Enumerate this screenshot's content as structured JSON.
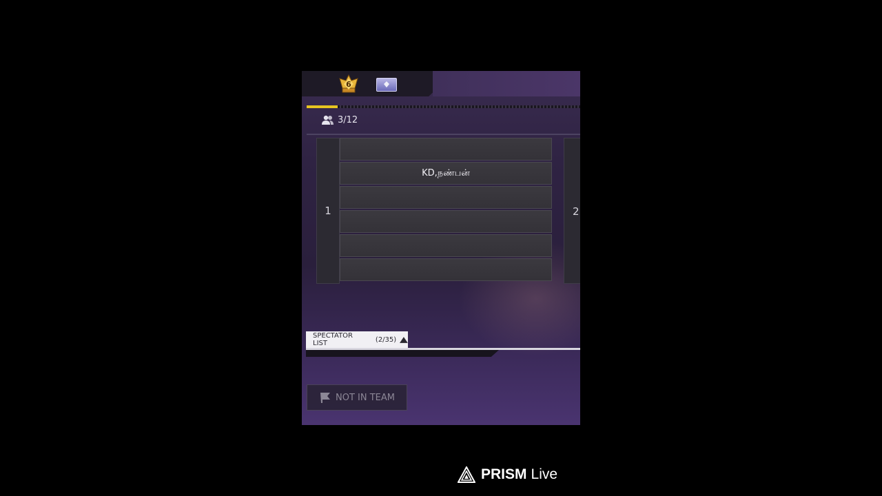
{
  "header": {
    "rank_level": "6",
    "rank_icon": "crown-rank-icon",
    "card_icon": "diamond-card-icon",
    "progress_fraction": 0.113
  },
  "room": {
    "player_count": "3/12",
    "players_icon": "players-icon"
  },
  "teams": [
    {
      "number": "1",
      "slots": [
        "",
        "KD,நண்பன்",
        "",
        "",
        "",
        ""
      ]
    },
    {
      "number": "2"
    }
  ],
  "spectator": {
    "label": "SPECTATOR LIST",
    "count": "(2/35)",
    "toggle_icon": "caret-up-icon"
  },
  "status_button": {
    "label": "NOT IN TEAM",
    "icon": "flag-icon"
  },
  "watermark": {
    "brand": "PRISM",
    "suffix": "Live",
    "logo_icon": "prism-triangle-icon"
  },
  "colors": {
    "progress": "#e7c420",
    "background_top": "#3a2c50",
    "background_bottom": "#4a3470"
  }
}
